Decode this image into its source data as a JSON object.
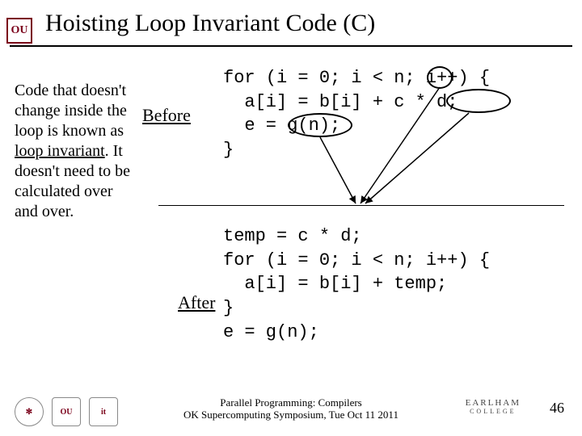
{
  "logo_tl": "OU",
  "title": "Hoisting Loop Invariant Code (C)",
  "paragraph_pre": "Code that doesn't change inside the loop is known as ",
  "paragraph_term": "loop invariant",
  "paragraph_post": ". It doesn't need to be calculated over and over.",
  "label_before": "Before",
  "label_after": "After",
  "code_before": "for (i = 0; i < n; i++) {\n  a[i] = b[i] + c * d;\n  e = g(n);\n}",
  "code_after": "temp = c * d;\nfor (i = 0; i < n; i++) {\n  a[i] = b[i] + temp;\n}\ne = g(n);",
  "footer_line1": "Parallel Programming: Compilers",
  "footer_line2": "OK Supercomputing Symposium, Tue Oct 11 2011",
  "earlham": "EARLHAM",
  "earlham_sub": "COLLEGE",
  "pagenum": "46",
  "badges": {
    "b1": "✻",
    "b2": "OU",
    "b3": "it"
  }
}
